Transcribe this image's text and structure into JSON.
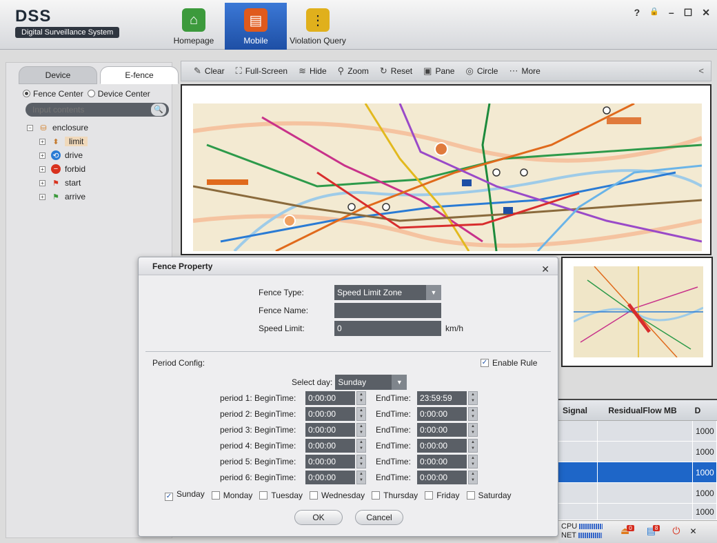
{
  "app": {
    "title": "DSS",
    "subtitle": "Digital Surveillance System",
    "controls": [
      "?",
      "🔒",
      "–",
      "☐",
      "✕"
    ]
  },
  "nav": [
    {
      "label": "Homepage",
      "icon": "home-icon",
      "color": "#3c9a3c"
    },
    {
      "label": "Mobile",
      "icon": "bus-icon",
      "color": "#e05a1c"
    },
    {
      "label": "Violation Query",
      "icon": "traffic-light-icon",
      "color": "#e0b01c"
    }
  ],
  "left": {
    "tabs": [
      "Device",
      "E-fence"
    ],
    "active_tab": "E-fence",
    "radio": [
      "Fence Center",
      "Device Center"
    ],
    "search_placeholder": "Input contents",
    "tree_root": "enclosure",
    "tree_items": [
      "limit",
      "drive",
      "forbid",
      "start",
      "arrive"
    ]
  },
  "toolbar": {
    "items": [
      "Clear",
      "Full-Screen",
      "Hide",
      "Zoom",
      "Reset",
      "Pane",
      "Circle",
      "More"
    ],
    "collapse": "<"
  },
  "table": {
    "headers": [
      "Signal",
      "ResidualFlow MB",
      "D"
    ],
    "rows": [
      "1000",
      "1000",
      "1000",
      "1000",
      "1000"
    ],
    "selected_row": 2
  },
  "status": {
    "cpu_label": "CPU",
    "net_label": "NET",
    "alarm_count": "0",
    "msg_count": "8"
  },
  "dialog": {
    "title": "Fence Property",
    "fence_type_label": "Fence Type:",
    "fence_type_value": "Speed Limit Zone",
    "fence_name_label": "Fence Name:",
    "fence_name_value": "",
    "speed_limit_label": "Speed Limit:",
    "speed_limit_value": "0",
    "speed_unit": "km/h",
    "period_config_label": "Period Config:",
    "enable_rule_label": "Enable Rule",
    "enable_rule_checked": true,
    "select_day_label": "Select day:",
    "select_day_value": "Sunday",
    "periods": [
      {
        "label": "period 1:",
        "begin_label": "BeginTime:",
        "begin": "0:00:00",
        "end_label": "EndTime:",
        "end": "23:59:59"
      },
      {
        "label": "period 2:",
        "begin_label": "BeginTime:",
        "begin": "0:00:00",
        "end_label": "EndTime:",
        "end": "0:00:00"
      },
      {
        "label": "period 3:",
        "begin_label": "BeginTime:",
        "begin": "0:00:00",
        "end_label": "EndTime:",
        "end": "0:00:00"
      },
      {
        "label": "period 4:",
        "begin_label": "BeginTime:",
        "begin": "0:00:00",
        "end_label": "EndTime:",
        "end": "0:00:00"
      },
      {
        "label": "period 5:",
        "begin_label": "BeginTime:",
        "begin": "0:00:00",
        "end_label": "EndTime:",
        "end": "0:00:00"
      },
      {
        "label": "period 6:",
        "begin_label": "BeginTime:",
        "begin": "0:00:00",
        "end_label": "EndTime:",
        "end": "0:00:00"
      }
    ],
    "days": [
      {
        "label": "Sunday",
        "checked": true
      },
      {
        "label": "Monday",
        "checked": false
      },
      {
        "label": "Tuesday",
        "checked": false
      },
      {
        "label": "Wednesday",
        "checked": false
      },
      {
        "label": "Thursday",
        "checked": false
      },
      {
        "label": "Friday",
        "checked": false
      },
      {
        "label": "Saturday",
        "checked": false
      }
    ],
    "ok_label": "OK",
    "cancel_label": "Cancel"
  }
}
